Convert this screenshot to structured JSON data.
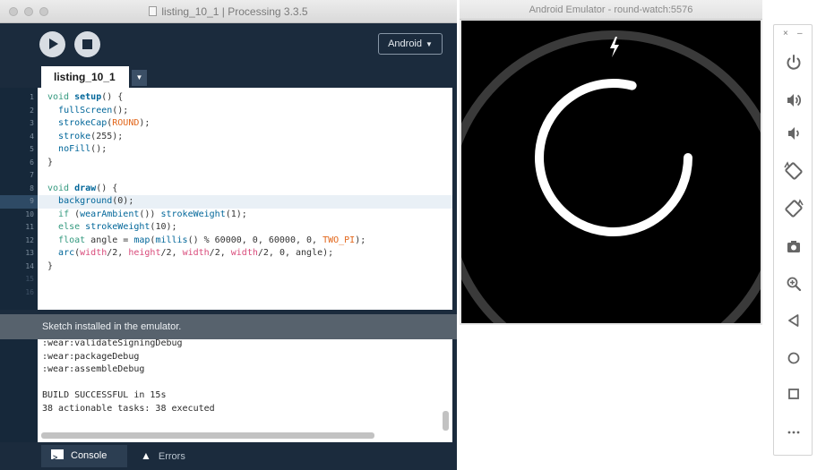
{
  "processing_window": {
    "title": "listing_10_1 | Processing 3.3.5",
    "mode_label": "Android",
    "tab_name": "listing_10_1",
    "code_lines": [
      {
        "n": "1",
        "spans": [
          {
            "t": "void",
            "c": "kw"
          },
          {
            "t": " "
          },
          {
            "t": "setup",
            "c": "fn"
          },
          {
            "t": "() {"
          }
        ]
      },
      {
        "n": "2",
        "spans": [
          {
            "t": "  "
          },
          {
            "t": "fullScreen",
            "c": "bi"
          },
          {
            "t": "();"
          }
        ]
      },
      {
        "n": "3",
        "spans": [
          {
            "t": "  "
          },
          {
            "t": "strokeCap",
            "c": "bi"
          },
          {
            "t": "("
          },
          {
            "t": "ROUND",
            "c": "lit"
          },
          {
            "t": ");"
          }
        ]
      },
      {
        "n": "4",
        "spans": [
          {
            "t": "  "
          },
          {
            "t": "stroke",
            "c": "bi"
          },
          {
            "t": "(255);"
          }
        ]
      },
      {
        "n": "5",
        "spans": [
          {
            "t": "  "
          },
          {
            "t": "noFill",
            "c": "bi"
          },
          {
            "t": "();"
          }
        ]
      },
      {
        "n": "6",
        "spans": [
          {
            "t": "}"
          }
        ]
      },
      {
        "n": "7",
        "spans": []
      },
      {
        "n": "8",
        "spans": [
          {
            "t": "void",
            "c": "kw"
          },
          {
            "t": " "
          },
          {
            "t": "draw",
            "c": "fn"
          },
          {
            "t": "() {"
          }
        ]
      },
      {
        "n": "9",
        "spans": [
          {
            "t": "  "
          },
          {
            "t": "background",
            "c": "bi"
          },
          {
            "t": "(0);"
          }
        ],
        "current": true
      },
      {
        "n": "10",
        "spans": [
          {
            "t": "  "
          },
          {
            "t": "if",
            "c": "kw"
          },
          {
            "t": " ("
          },
          {
            "t": "wearAmbient",
            "c": "bi"
          },
          {
            "t": "()) "
          },
          {
            "t": "strokeWeight",
            "c": "bi"
          },
          {
            "t": "(1);"
          }
        ]
      },
      {
        "n": "11",
        "spans": [
          {
            "t": "  "
          },
          {
            "t": "else",
            "c": "kw"
          },
          {
            "t": " "
          },
          {
            "t": "strokeWeight",
            "c": "bi"
          },
          {
            "t": "(10);"
          }
        ]
      },
      {
        "n": "12",
        "spans": [
          {
            "t": "  "
          },
          {
            "t": "float",
            "c": "kw"
          },
          {
            "t": " angle = "
          },
          {
            "t": "map",
            "c": "bi"
          },
          {
            "t": "("
          },
          {
            "t": "millis",
            "c": "bi"
          },
          {
            "t": "() % 60000, 0, 60000, 0, "
          },
          {
            "t": "TWO_PI",
            "c": "lit"
          },
          {
            "t": ");"
          }
        ]
      },
      {
        "n": "13",
        "spans": [
          {
            "t": "  "
          },
          {
            "t": "arc",
            "c": "bi"
          },
          {
            "t": "("
          },
          {
            "t": "width",
            "c": "cs"
          },
          {
            "t": "/2, "
          },
          {
            "t": "height",
            "c": "cs"
          },
          {
            "t": "/2, "
          },
          {
            "t": "width",
            "c": "cs"
          },
          {
            "t": "/2, "
          },
          {
            "t": "width",
            "c": "cs"
          },
          {
            "t": "/2, 0, angle);"
          }
        ]
      },
      {
        "n": "14",
        "spans": [
          {
            "t": "}"
          }
        ]
      },
      {
        "n": "15",
        "spans": [],
        "dim": true
      },
      {
        "n": "16",
        "spans": [],
        "dim": true
      }
    ],
    "status_message": "Sketch installed in the emulator.",
    "console_lines": [
      ":wear:validateSigningDebug",
      ":wear:packageDebug",
      ":wear:assembleDebug",
      "",
      "BUILD SUCCESSFUL in 15s",
      "38 actionable tasks: 38 executed"
    ],
    "bottom_tabs": {
      "console": "Console",
      "errors": "Errors"
    }
  },
  "emulator_window": {
    "title": "Android Emulator - round-watch:5576",
    "screen": {
      "background": "#000000",
      "bezel_color": "#3a3a3a",
      "arc_color": "#ffffff",
      "charging_icon": "lightning-bolt-icon",
      "arc_fraction_elapsed": 0.79
    }
  },
  "control_panel": {
    "close_glyph": "×",
    "minimize_glyph": "–",
    "buttons": [
      {
        "name": "power-button",
        "icon": "power-icon"
      },
      {
        "name": "volume-up-button",
        "icon": "volume-up-icon"
      },
      {
        "name": "volume-down-button",
        "icon": "volume-down-icon"
      },
      {
        "name": "rotate-left-button",
        "icon": "rotate-left-icon"
      },
      {
        "name": "rotate-right-button",
        "icon": "rotate-right-icon"
      },
      {
        "name": "screenshot-button",
        "icon": "camera-icon"
      },
      {
        "name": "zoom-button",
        "icon": "zoom-icon"
      },
      {
        "name": "back-button",
        "icon": "back-triangle-icon"
      },
      {
        "name": "home-button",
        "icon": "home-circle-icon"
      },
      {
        "name": "overview-button",
        "icon": "overview-square-icon"
      },
      {
        "name": "more-button",
        "icon": "more-dots-icon"
      }
    ]
  },
  "colors": {
    "pde_dark": "#1b2b3d",
    "keyword": "#33997e",
    "function": "#006699",
    "constant": "#d94a7a",
    "literal": "#e2661a",
    "icon_gray": "#666666"
  }
}
